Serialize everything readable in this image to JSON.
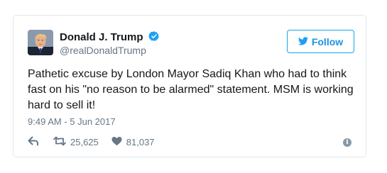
{
  "user": {
    "name": "Donald J. Trump",
    "handle": "@realDonaldTrump",
    "verified": true
  },
  "follow_button": {
    "label": "Follow",
    "icon": "bird-icon"
  },
  "tweet": {
    "text": "Pathetic excuse by London Mayor Sadiq Khan who had to think fast on his \"no reason to be alarmed\" statement. MSM is working hard to sell it!",
    "timestamp": "9:49 AM - 5 Jun 2017"
  },
  "actions": {
    "reply_icon": "reply-icon",
    "retweet_icon": "retweet-icon",
    "retweet_count": "25,625",
    "like_icon": "heart-icon",
    "like_count": "81,037",
    "info_icon": "info-icon"
  },
  "colors": {
    "brand": "#1da1f2",
    "text": "#14171a",
    "muted": "#657786",
    "border": "#e1e8ed"
  }
}
